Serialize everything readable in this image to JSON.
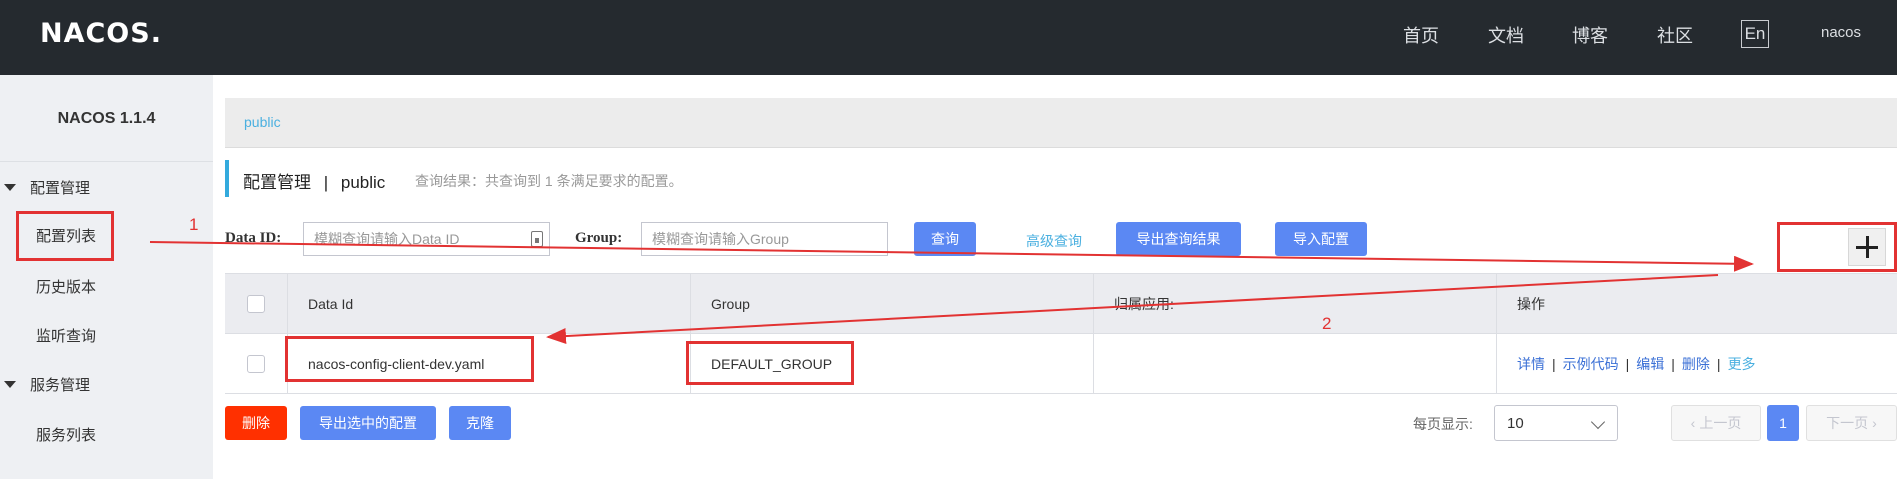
{
  "header": {
    "logo": "NACOS.",
    "nav": [
      "首页",
      "文档",
      "博客",
      "社区"
    ],
    "lang": "En",
    "user": "nacos"
  },
  "sidebar": {
    "version": "NACOS 1.1.4",
    "groups": [
      {
        "label": "配置管理",
        "items": [
          "配置列表",
          "历史版本",
          "监听查询"
        ]
      },
      {
        "label": "服务管理",
        "items": [
          "服务列表"
        ]
      }
    ]
  },
  "breadcrumb": "public",
  "section": {
    "title": "配置管理",
    "separator": "|",
    "namespace": "public",
    "result_hint": "查询结果：共查询到 1 条满足要求的配置。"
  },
  "search": {
    "dataid_label": "Data ID:",
    "dataid_placeholder": "模糊查询请输入Data ID",
    "group_label": "Group:",
    "group_placeholder": "模糊查询请输入Group",
    "query_button": "查询",
    "advanced_link": "高级查询",
    "export_button": "导出查询结果",
    "import_button": "导入配置"
  },
  "table": {
    "columns": [
      "Data Id",
      "Group",
      "归属应用:",
      "操作"
    ],
    "rows": [
      {
        "data_id": "nacos-config-client-dev.yaml",
        "group": "DEFAULT_GROUP",
        "app": "",
        "actions": [
          "详情",
          "示例代码",
          "编辑",
          "删除",
          "更多"
        ]
      }
    ]
  },
  "footer": {
    "delete_button": "删除",
    "export_selected_button": "导出选中的配置",
    "clone_button": "克隆",
    "page_size_label": "每页显示:",
    "page_size_value": "10",
    "prev": "上一页",
    "current_page": "1",
    "next": "下一页"
  },
  "annotations": {
    "label_1": "1",
    "label_2": "2",
    "color": "#e23232"
  },
  "colors": {
    "topbar": "#252a2f",
    "primary_button": "#5b88f3",
    "danger_button": "#ff3000",
    "link": "#4bb0e0",
    "action_link": "#3b70d6"
  }
}
